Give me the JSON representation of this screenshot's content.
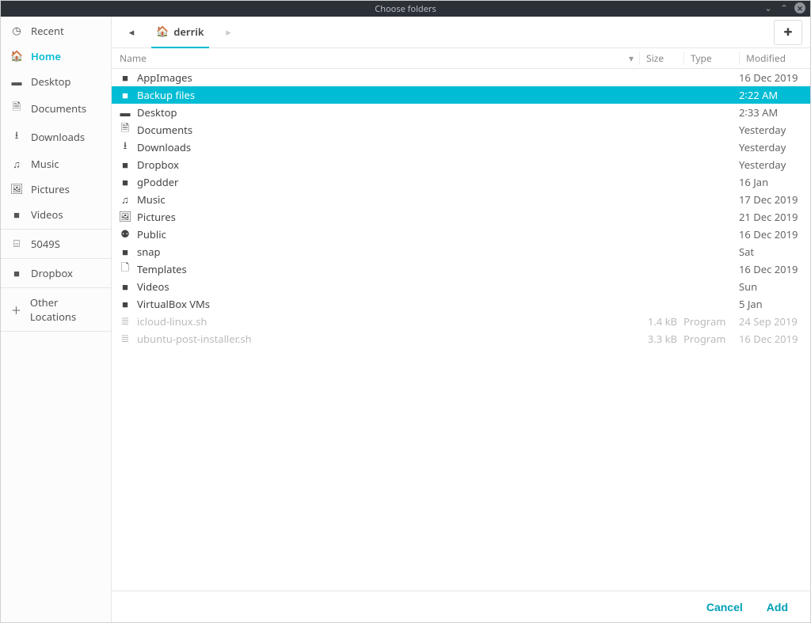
{
  "title": "Choose folders",
  "accent": "#00bcd4",
  "sidebar": {
    "groups": [
      {
        "items": [
          {
            "icon": "clock-icon",
            "glyph": "◷",
            "label": "Recent"
          },
          {
            "icon": "home-icon",
            "glyph": "🏠",
            "label": "Home",
            "active": true
          },
          {
            "icon": "desktop-icon",
            "glyph": "▬",
            "label": "Desktop"
          },
          {
            "icon": "document-icon",
            "glyph": "🗎",
            "label": "Documents"
          },
          {
            "icon": "download-icon",
            "glyph": "⭳",
            "label": "Downloads"
          },
          {
            "icon": "music-icon",
            "glyph": "♫",
            "label": "Music"
          },
          {
            "icon": "pictures-icon",
            "glyph": "🖼",
            "label": "Pictures"
          },
          {
            "icon": "video-icon",
            "glyph": "■",
            "label": "Videos"
          }
        ]
      },
      {
        "items": [
          {
            "icon": "drive-icon",
            "glyph": "⌸",
            "label": "5049S"
          }
        ]
      },
      {
        "items": [
          {
            "icon": "folder-icon",
            "glyph": "■",
            "label": "Dropbox"
          }
        ]
      },
      {
        "items": [
          {
            "icon": "plus-icon",
            "glyph": "＋",
            "label": "Other Locations"
          }
        ]
      }
    ]
  },
  "breadcrumb": {
    "back_glyph": "◂",
    "fwd_glyph": "▸",
    "home_glyph": "🏠",
    "current": "derrik"
  },
  "toolbar": {
    "new_folder_glyph": "✚"
  },
  "columns": {
    "name": "Name",
    "sort_glyph": "▾",
    "size": "Size",
    "type": "Type",
    "modified": "Modified"
  },
  "rows": [
    {
      "icon": "folder-icon",
      "glyph": "■",
      "name": "AppImages",
      "modified": "16 Dec 2019"
    },
    {
      "icon": "folder-icon",
      "glyph": "■",
      "name": "Backup files",
      "modified": "2∶22 AM",
      "selected": true
    },
    {
      "icon": "desktop-icon",
      "glyph": "▬",
      "name": "Desktop",
      "modified": "2∶33 AM"
    },
    {
      "icon": "document-icon",
      "glyph": "🗎",
      "name": "Documents",
      "modified": "Yesterday"
    },
    {
      "icon": "download-icon",
      "glyph": "⭳",
      "name": "Downloads",
      "modified": "Yesterday"
    },
    {
      "icon": "folder-icon",
      "glyph": "■",
      "name": "Dropbox",
      "modified": "Yesterday"
    },
    {
      "icon": "folder-icon",
      "glyph": "■",
      "name": "gPodder",
      "modified": "16 Jan"
    },
    {
      "icon": "music-icon",
      "glyph": "♫",
      "name": "Music",
      "modified": "17 Dec 2019"
    },
    {
      "icon": "pictures-icon",
      "glyph": "🖼",
      "name": "Pictures",
      "modified": "21 Dec 2019"
    },
    {
      "icon": "public-icon",
      "glyph": "⚉",
      "name": "Public",
      "modified": "16 Dec 2019"
    },
    {
      "icon": "folder-icon",
      "glyph": "■",
      "name": "snap",
      "modified": "Sat"
    },
    {
      "icon": "template-icon",
      "glyph": "🗋",
      "name": "Templates",
      "modified": "16 Dec 2019"
    },
    {
      "icon": "video-icon",
      "glyph": "■",
      "name": "Videos",
      "modified": "Sun"
    },
    {
      "icon": "folder-icon",
      "glyph": "■",
      "name": "VirtualBox VMs",
      "modified": "5 Jan"
    },
    {
      "icon": "script-icon",
      "glyph": "≣",
      "name": "icloud-linux.sh",
      "size": "1.4 kB",
      "type": "Program",
      "modified": "24 Sep 2019",
      "dim": true
    },
    {
      "icon": "script-icon",
      "glyph": "≣",
      "name": "ubuntu-post-installer.sh",
      "size": "3.3 kB",
      "type": "Program",
      "modified": "16 Dec 2019",
      "dim": true
    }
  ],
  "footer": {
    "cancel": "Cancel",
    "confirm": "Add"
  }
}
